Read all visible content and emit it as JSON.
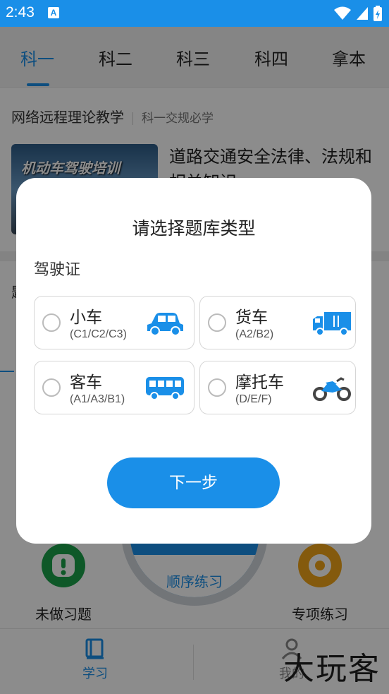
{
  "status_bar": {
    "time": "2:43",
    "app_icon_letter": "A"
  },
  "tabs": [
    {
      "label": "科一",
      "active": true
    },
    {
      "label": "科二",
      "active": false
    },
    {
      "label": "科三",
      "active": false
    },
    {
      "label": "科四",
      "active": false
    },
    {
      "label": "拿本",
      "active": false
    }
  ],
  "section": {
    "title": "网络远程理论教学",
    "subtitle": "科一交规必学"
  },
  "lesson": {
    "thumbnail_text": "机动车驾驶培训",
    "title": "道路交通安全法律、法规和相关知识"
  },
  "background": {
    "partial_left_text": "题",
    "dial_label": "顺序练习",
    "feature_left": "未做习题",
    "feature_right": "专项练习",
    "nav_study": "学习",
    "nav_mine": "我的"
  },
  "dialog": {
    "title": "请选择题库类型",
    "section_label": "驾驶证",
    "options": [
      {
        "name": "小车",
        "sub": "(C1/C2/C3)",
        "icon": "car-icon"
      },
      {
        "name": "货车",
        "sub": "(A2/B2)",
        "icon": "truck-icon"
      },
      {
        "name": "客车",
        "sub": "(A1/A3/B1)",
        "icon": "bus-icon"
      },
      {
        "name": "摩托车",
        "sub": "(D/E/F)",
        "icon": "motorcycle-icon"
      }
    ],
    "next_button": "下一步"
  },
  "watermark": "大玩客",
  "colors": {
    "accent": "#1a8fe8",
    "green": "#1aa04a",
    "orange": "#f0a418"
  }
}
